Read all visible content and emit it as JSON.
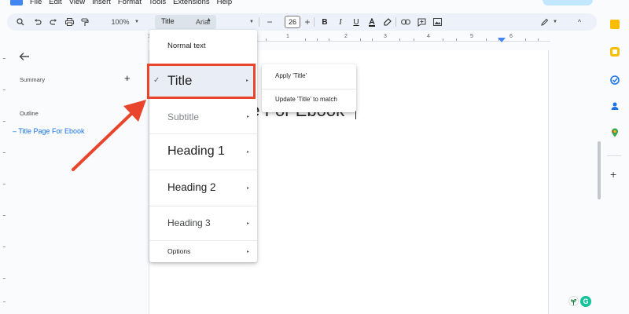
{
  "menubar": {
    "items": [
      "File",
      "Edit",
      "View",
      "Insert",
      "Format",
      "Tools",
      "Extensions",
      "Help"
    ]
  },
  "toolbar": {
    "zoom": "100%",
    "style_value": "Title",
    "font_value": "Arial",
    "font_size": "26",
    "icons": [
      "search-icon",
      "undo-icon",
      "redo-icon",
      "print-icon",
      "paint-format-icon",
      "bold-icon",
      "italic-icon",
      "underline-icon",
      "text-color-icon",
      "highlight-icon",
      "link-icon",
      "comment-icon",
      "image-icon",
      "edit-mode-icon",
      "collapse-icon"
    ]
  },
  "ruler": {
    "numbers": [
      "1",
      "1",
      "2",
      "3",
      "4",
      "5",
      "6"
    ]
  },
  "outline_panel": {
    "summary_label": "Summary",
    "add_label": "+",
    "outline_label": "Outline",
    "outline_item": "Title Page For Ebook"
  },
  "document": {
    "visible_text": "ge For Ebook"
  },
  "style_menu": {
    "items": [
      {
        "label": "Normal text",
        "has_submenu": false
      },
      {
        "label": "Title",
        "has_submenu": true,
        "checked": true
      },
      {
        "label": "Subtitle",
        "has_submenu": true
      },
      {
        "label": "Heading 1",
        "has_submenu": true
      },
      {
        "label": "Heading 2",
        "has_submenu": true
      },
      {
        "label": "Heading 3",
        "has_submenu": true
      },
      {
        "label": "Options",
        "has_submenu": true
      }
    ],
    "arrow_glyph": "▸",
    "check_glyph": "✓"
  },
  "submenu": {
    "apply": "Apply 'Title'",
    "update": "Update 'Title' to match"
  },
  "colors": {
    "accent": "#1a73e8",
    "annotation": "#e8452c",
    "toolbar_bg": "#edf2fa"
  },
  "badges": {
    "grammarly": "G"
  }
}
